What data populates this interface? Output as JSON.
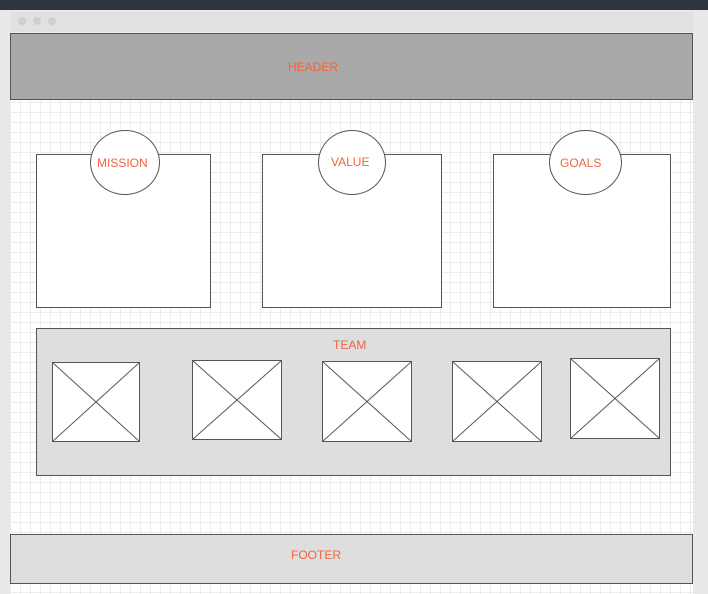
{
  "wireframe": {
    "header_label": "HEADER",
    "sections": [
      {
        "label": "MISSION"
      },
      {
        "label": "VALUE"
      },
      {
        "label": "GOALS"
      }
    ],
    "team_label": "TEAM",
    "team_members_count": 5,
    "footer_label": "FOOTER"
  },
  "colors": {
    "label": "#f0643c",
    "header_bg": "#a9a9a9",
    "panel_bg": "#dedede",
    "titlebar_bg": "#2d3540"
  }
}
